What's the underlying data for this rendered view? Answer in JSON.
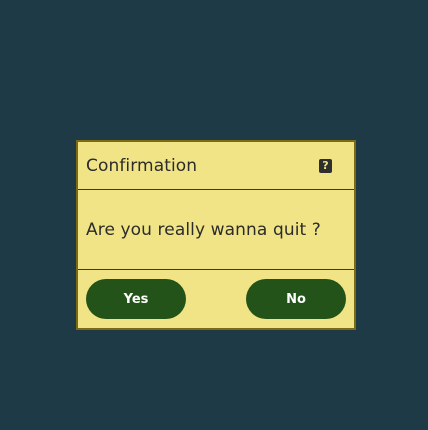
{
  "colors": {
    "background": "#1f3a47",
    "dialog_fill": "#f0e486",
    "dialog_border": "#7a6a14",
    "button_fill": "#24531a",
    "button_text": "#ffffff"
  },
  "dialog": {
    "title": "Confirmation",
    "help_icon": "question-icon",
    "help_glyph": "?",
    "message": "Are you really wanna quit ?",
    "buttons": {
      "yes_label": "Yes",
      "no_label": "No"
    }
  }
}
